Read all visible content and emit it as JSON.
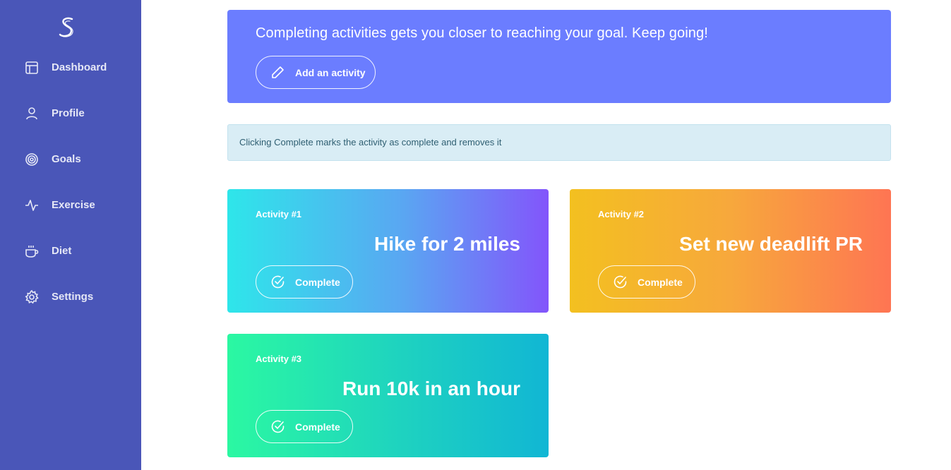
{
  "sidebar": {
    "logo_icon": "s-logo-icon",
    "items": [
      {
        "label": "Dashboard",
        "icon": "dashboard-icon"
      },
      {
        "label": "Profile",
        "icon": "user-icon"
      },
      {
        "label": "Goals",
        "icon": "target-icon"
      },
      {
        "label": "Exercise",
        "icon": "activity-icon"
      },
      {
        "label": "Diet",
        "icon": "coffee-icon"
      },
      {
        "label": "Settings",
        "icon": "gear-icon"
      }
    ]
  },
  "banner": {
    "message": "Completing activities gets you closer to reaching your goal. Keep going!",
    "add_button_label": "Add an activity",
    "add_button_icon": "pencil-icon"
  },
  "alert": {
    "text": "Clicking Complete marks the activity as complete and removes it"
  },
  "activities": [
    {
      "number_label": "Activity #1",
      "title": "Hike for 2 miles",
      "button_label": "Complete"
    },
    {
      "number_label": "Activity #2",
      "title": "Set new deadlift PR",
      "button_label": "Complete"
    },
    {
      "number_label": "Activity #3",
      "title": "Run 10k in an hour",
      "button_label": "Complete"
    }
  ],
  "colors": {
    "sidebar_bg": "#4a56b8",
    "banner_bg": "#6b7dff",
    "alert_bg": "#d9edf5",
    "alert_text": "#2f5f72"
  }
}
